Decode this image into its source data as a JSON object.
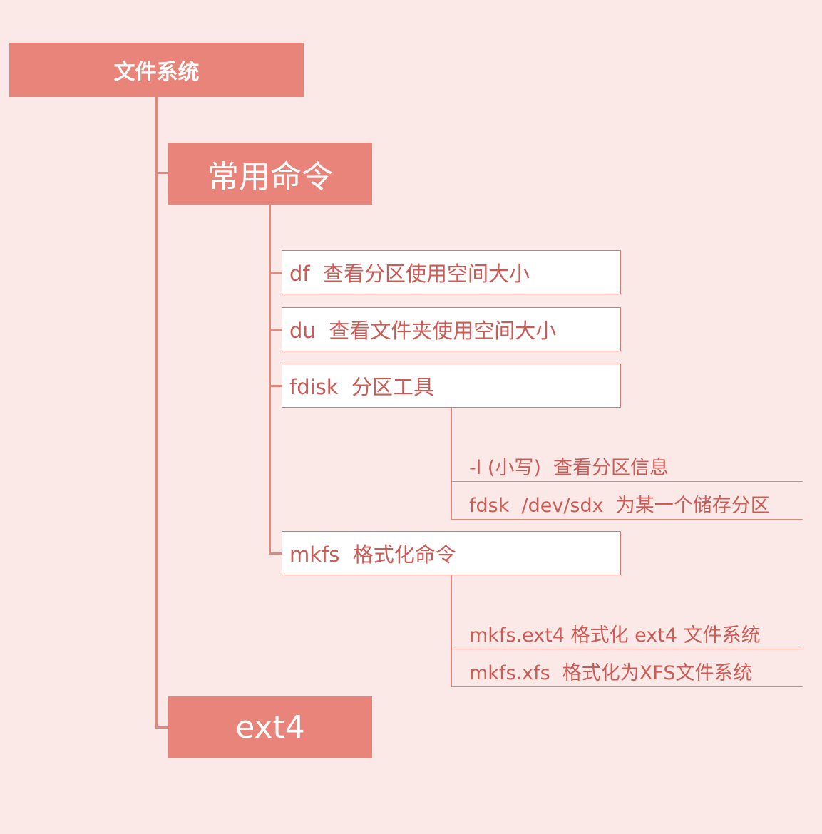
{
  "colors": {
    "background": "#fbe9e8",
    "node_fill": "#e8847a",
    "connector": "#e8857a",
    "text_accent": "#cc5a55"
  },
  "root": {
    "label": "文件系统"
  },
  "branches": [
    {
      "label": "常用命令",
      "children": [
        {
          "label": "df  查看分区使用空间大小"
        },
        {
          "label": "du  查看文件夹使用空间大小"
        },
        {
          "label": "fdisk  分区工具",
          "children": [
            {
              "label": "-l (小写)  查看分区信息"
            },
            {
              "label": "fdsk  /dev/sdx  为某一个储存分区"
            }
          ]
        },
        {
          "label": "mkfs  格式化命令",
          "children": [
            {
              "label": "mkfs.ext4 格式化 ext4 文件系统"
            },
            {
              "label": "mkfs.xfs  格式化为XFS文件系统"
            }
          ]
        }
      ]
    },
    {
      "label": "ext4"
    }
  ]
}
